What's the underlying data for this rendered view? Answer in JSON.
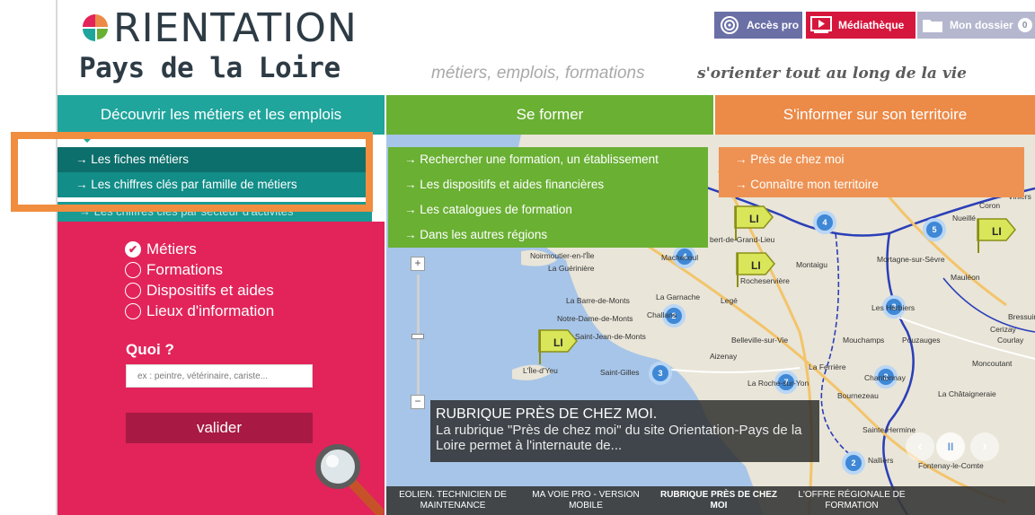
{
  "brand": {
    "title_rest": "RIENTATION",
    "subtitle": "Pays de la Loire",
    "tagline_light": "métiers, emplois, formations",
    "tagline_bold": "s'orienter tout au long de la vie"
  },
  "topbar": {
    "pro_label": "Accès pro",
    "media_label": "Médiathèque",
    "dossier_label": "Mon dossier",
    "dossier_count": "0"
  },
  "nav": [
    {
      "label": "Découvrir les métiers et les emplois",
      "color": "#1fa59c"
    },
    {
      "label": "Se former",
      "color": "#6ab033"
    },
    {
      "label": "S'informer sur son territoire",
      "color": "#ec8a47"
    }
  ],
  "menu_discover": [
    "→ Les fiches métiers",
    "→ Les chiffres clés par famille de métiers",
    "→ Les chiffres clés par secteur d'activités"
  ],
  "menu_form": [
    "→ Rechercher une formation, un établissement",
    "→ Les dispositifs et aides financières",
    "→ Les catalogues de formation",
    "→ Dans les autres régions"
  ],
  "menu_territory": [
    "→ Près de chez moi",
    "→ Connaître mon territoire"
  ],
  "search": {
    "options": [
      "Métiers",
      "Formations",
      "Dispositifs et aides",
      "Lieux d'information"
    ],
    "selected": "Métiers",
    "quoi_label": "Quoi ?",
    "placeholder": "ex : peintre, vétérinaire, cariste...",
    "submit_label": "valider"
  },
  "map": {
    "zoom_in": "+",
    "zoom_out": "−",
    "marker_label": "LI",
    "places": [
      "Noirmoutier-en-l'Île",
      "La Guérinière",
      "Machecoul",
      "La Barre-de-Monts",
      "Notre-Dame-de-Monts",
      "Saint-Jean-de-Monts",
      "L'Île-d'Yeu",
      "Saint-Gilles",
      "La Garnache",
      "Challans",
      "Montaigu",
      "Rocheservière",
      "Legé",
      "Les Herbiers",
      "Mortagne-sur-Sèvre",
      "Mauléon",
      "Belleville-sur-Vie",
      "Mouchamps",
      "Pouzauges",
      "Aizenay",
      "La Ferrière",
      "La Roche-sur-Yon",
      "Chantonnay",
      "Bournezeau",
      "La Châtaigneraie",
      "Sainte-Hermine",
      "Nalliers",
      "Fontenay-le-Comte",
      "Moncoutant",
      "Courlay",
      "Bressuire",
      "Cerizay",
      "Nueillé",
      "Coron",
      "Vihiers",
      "bert-de-Grand-Lieu"
    ],
    "clusters": [
      "4",
      "4",
      "5",
      "2",
      "3",
      "3",
      "7",
      "2",
      "2",
      "2"
    ]
  },
  "slideshow": {
    "title": "RUBRIQUE PRÈS DE CHEZ MOI.",
    "text": "La rubrique \"Près de chez moi\" du site Orientation-Pays de la Loire permet à l'internaute de...",
    "prev": "‹",
    "pause": "II",
    "next": "›",
    "tabs": [
      "EOLIEN. TECHNICIEN DE MAINTENANCE",
      "MA VOIE PRO - VERSION MOBILE",
      "RUBRIQUE PRÈS DE CHEZ MOI",
      "L'OFFRE RÉGIONALE DE FORMATION"
    ],
    "active_tab": 2
  }
}
